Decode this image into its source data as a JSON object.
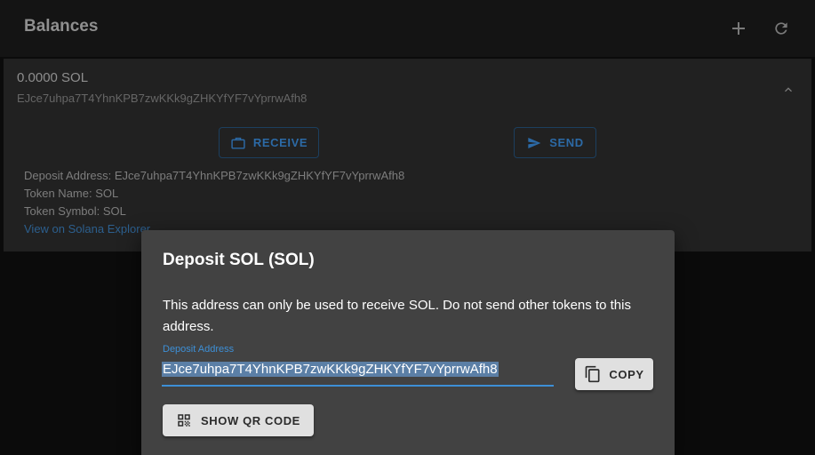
{
  "header": {
    "title": "Balances",
    "add_icon": "plus-icon",
    "refresh_icon": "refresh-icon"
  },
  "balance": {
    "amount": "0.0000 SOL",
    "address": "EJce7uhpa7T4YhnKPB7zwKKk9gZHKYfYF7vYprrwAfh8",
    "receive_label": "RECEIVE",
    "send_label": "SEND",
    "details": {
      "deposit_address": "Deposit Address: EJce7uhpa7T4YhnKPB7zwKKk9gZHKYfYF7vYprrwAfh8",
      "token_name": "Token Name: SOL",
      "token_symbol": "Token Symbol: SOL",
      "explorer_link": "View on Solana Explorer"
    }
  },
  "dialog": {
    "title": "Deposit SOL (SOL)",
    "body": "This address can only be used to receive SOL. Do not send other tokens to this address.",
    "field_label": "Deposit Address",
    "field_value": "EJce7uhpa7T4YhnKPB7zwKKk9gZHKYfYF7vYprrwAfh8",
    "copy_label": "COPY",
    "qr_label": "SHOW QR CODE"
  },
  "colors": {
    "accent": "#3d8fd6",
    "dialog_bg": "#424242",
    "button_bg": "#e0e0e0"
  }
}
